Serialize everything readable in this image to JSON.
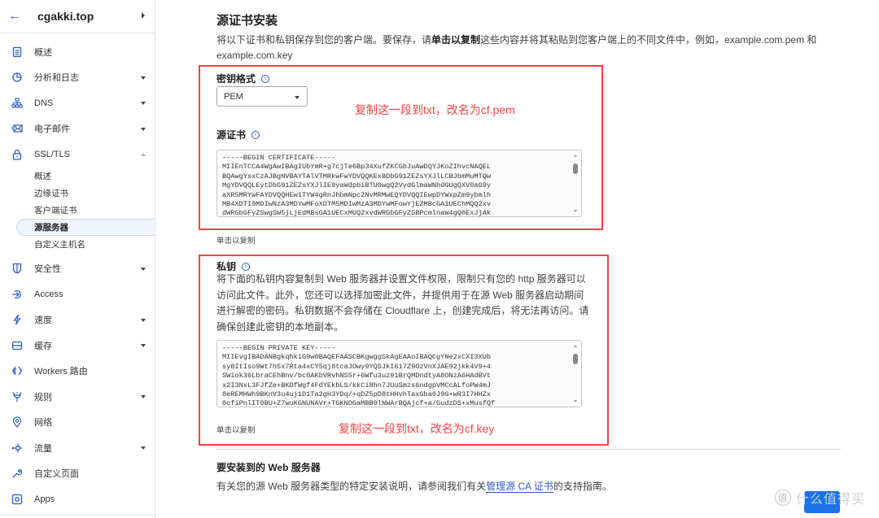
{
  "sidebar": {
    "back_icon": "arrow-left-icon",
    "domain": "cgakki.top",
    "items": [
      {
        "label": "概述",
        "icon": "clipboard-icon",
        "caret": false
      },
      {
        "label": "分析和日志",
        "icon": "pie-chart-icon",
        "caret": true
      },
      {
        "label": "DNS",
        "icon": "network-icon",
        "caret": true
      },
      {
        "label": "电子邮件",
        "icon": "envelope-icon",
        "caret": true
      },
      {
        "label": "SSL/TLS",
        "icon": "lock-icon",
        "caret": "up",
        "expanded": true
      },
      {
        "label": "安全性",
        "icon": "shield-icon",
        "caret": true
      },
      {
        "label": "Access",
        "icon": "access-icon",
        "caret": false
      },
      {
        "label": "速度",
        "icon": "lightning-icon",
        "caret": true
      },
      {
        "label": "缓存",
        "icon": "storage-icon",
        "caret": true
      },
      {
        "label": "Workers 路由",
        "icon": "workers-icon",
        "caret": false
      },
      {
        "label": "规则",
        "icon": "filter-icon",
        "caret": true
      },
      {
        "label": "网络",
        "icon": "location-pin-icon",
        "caret": false
      },
      {
        "label": "流量",
        "icon": "traffic-icon",
        "caret": true
      },
      {
        "label": "自定义页面",
        "icon": "wrench-icon",
        "caret": false
      },
      {
        "label": "Apps",
        "icon": "apps-icon",
        "caret": false
      }
    ],
    "ssl_subitems": [
      {
        "label": "概述",
        "active": false
      },
      {
        "label": "边缘证书",
        "active": false
      },
      {
        "label": "客户端证书",
        "active": false
      },
      {
        "label": "源服务器",
        "active": true
      },
      {
        "label": "自定义主机名",
        "active": false
      }
    ]
  },
  "main": {
    "title": "源证书安装",
    "desc_part1": "将以下证书和私钥保存到您的客户端。要保存，请",
    "desc_bold": "单击以复制",
    "desc_part2": "这些内容并将其粘贴到您客户端上的不同文件中，例如，example.com.pem 和 example.com.key",
    "key_format_label": "密钥格式",
    "key_format_value": "PEM",
    "origin_cert_label": "源证书",
    "certificate_text": "-----BEGIN CERTIFICATE-----\nMIIEnTCCA4WgAwIBAgIUbYmR+g7cjTe6Bp34XufZKCGbJuAwDQYJKoZIhvcNAQEL\nBQAwgYsxCzAJBgNVBAYTAlVTMRkwFwYDVQQKExBDbG91ZEZsYXJlLCBJbmMuMTQw\nMgYDVQQLEytDbG91ZEZsYXJlIE9yaWdpbiBTU0wgQ2VydGlmaWNhdGUgQXV0aG9y\naXR5MRYwFAYDVQQHEw1TYW4gRnJhbmNpc2NvMRMwEQYDVQQIEwpDYWxpZm9ybmlh\nMB4XDTI0MDIwNzA3MDYwMFoXDTM5MDIwMzA3MDYwMFowYjEZMBcGA1UEChMQQ2xv\ndWRGbGFyZSwgSW5jLjEdMBsGA1UECxMUQ2xvdWRGbGFyZSBPcmlnaW4gQ0ExJjAk",
    "cert_copy_hint": "单击以复制",
    "annotation_pem": "复制这一段到txt，改名为cf.pem",
    "private_key_label": "私钥",
    "private_key_desc": "将下面的私钥内容复制到 Web 服务器并设置文件权限，限制只有您的 http 服务器可以访问此文件。此外，您还可以选择加密此文件，并提供用于在源 Web 服务器启动期间进行解密的密码。私钥数据不会存储在 Cloudflare 上，创建完成后，将无法再访问。请确保创建此密钥的本地副本。",
    "private_key_text": "-----BEGIN PRIVATE KEY-----\nMIIEvgIBADANBgkqhkiG9w0BAQEFAASCBKgwggSkAgEAAoIBAQCgYNe2xCXI3XUb\nsy0ItIso9Wt7h5x7Rta4xCY5qj8tcaJOwy9YQSJkI617Z9OzVnXJAE92jkk4V9+4\nSWiok36LbraCEhBnv/bc0AKbVRvhNS5r+6Wfu3uz91BrQMDndtyA8ONzA6HAdBVt\nx2I3NxL3FJfZe+BKDfWgf4FdYEkbLS/kkCi8hn7JUuSmzs6ndgpVMCcALfoPW4mJ\n8eREMHWh9BKnV3u4uj1D1Ta2gH3YDq/+qDZ5pD8tHHvhTaxGba0J9G+wR3I7HHZx\n0cfiPnlIT0BU+Z7wuKGNUNAVr+TGKNDGaMBB9lNWArBQAjcf+a/GudzDS+xMusfQf",
    "key_copy_hint": "单击以复制",
    "annotation_key": "复制这一段到txt，改名为cf.key",
    "web_server_title": "要安装到的 Web 服务器",
    "web_server_desc_before": "有关您的源 Web 服务器类型的特定安装说明，请参阅我们有关",
    "web_server_link": "管理源 CA 证书",
    "web_server_desc_after": "的支持指南。"
  },
  "watermark": {
    "circle": "值",
    "text": "什么值得买"
  },
  "colors": {
    "accent": "#2d5bbd",
    "annotation_red": "#f04444",
    "button_blue": "#1a73e8"
  }
}
